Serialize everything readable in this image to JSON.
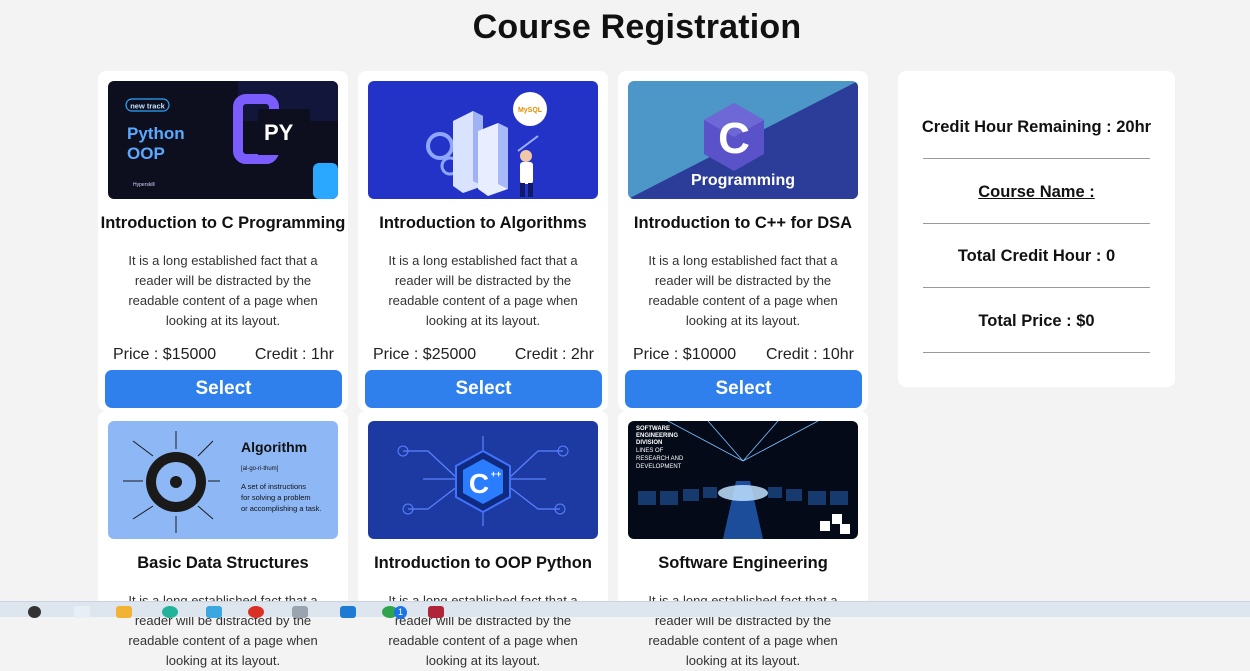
{
  "page": {
    "title": "Course Registration"
  },
  "courses": [
    {
      "title": "Introduction to C Programming",
      "description": "It is a long established fact that a reader will be distracted by the readable content of a page when looking at its layout.",
      "price": "Price : $15000",
      "credit": "Credit : 1hr",
      "button": "Select",
      "thumb": {
        "badge": "new track",
        "line1": "Python",
        "line2": "OOP",
        "mark": "PY",
        "brand": "Hyperskill"
      }
    },
    {
      "title": "Introduction to Algorithms",
      "description": "It is a long established fact that a reader will be distracted by the readable content of a page when looking at its layout.",
      "price": "Price : $25000",
      "credit": "Credit : 2hr",
      "button": "Select",
      "thumb": {
        "label": "MySQL"
      }
    },
    {
      "title": "Introduction to C++ for DSA",
      "description": "It is a long established fact that a reader will be distracted by the readable content of a page when looking at its layout.",
      "price": "Price : $10000",
      "credit": "Credit : 10hr",
      "button": "Select",
      "thumb": {
        "letter": "C",
        "label": "Programming"
      }
    },
    {
      "title": "Basic Data Structures",
      "description": "It is a long established fact that a reader will be distracted by the readable content of a page when looking at its layout.",
      "thumb": {
        "heading": "Algorithm",
        "phonetic": "[al-go-ri-thum]",
        "line1": "A set of instructions",
        "line2": "for solving a problem",
        "line3": "or accomplishing a task."
      }
    },
    {
      "title": "Introduction to OOP Python",
      "description": "It is a long established fact that a reader will be distracted by the readable content of a page when looking at its layout.",
      "thumb": {
        "letter": "C",
        "sup": "++"
      }
    },
    {
      "title": "Software Engineering",
      "description": "It is a long established fact that a reader will be distracted by the readable content of a page when looking at its layout.",
      "thumb": {
        "line1": "SOFTWARE",
        "line2": "ENGINEERING",
        "line3": "DIVISION",
        "line4": "LINES OF",
        "line5": "RESEARCH AND",
        "line6": "DEVELOPMENT"
      }
    }
  ],
  "summary": {
    "credit_remaining": "Credit Hour Remaining : 20hr",
    "course_name_label": "Course Name :",
    "total_credit": "Total Credit Hour : 0",
    "total_price": "Total Price : $0"
  },
  "taskbar": {
    "badge": "1"
  },
  "colors": {
    "accent": "#2f80ed",
    "background": "#f3f3f3"
  }
}
